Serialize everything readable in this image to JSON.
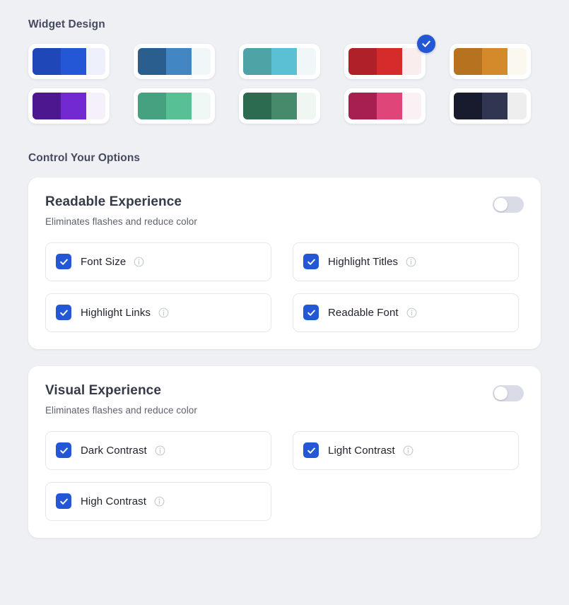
{
  "sections": {
    "widget_design_heading": "Widget Design",
    "control_options_heading": "Control Your Options"
  },
  "theme": {
    "accent": "#2457d6",
    "page_background": "#eef0f4",
    "card_background": "#ffffff",
    "heading_color": "#454a5f"
  },
  "swatches": [
    {
      "name": "blue",
      "selected": false,
      "colors": [
        "#1f47b8",
        "#2457d6",
        "#eef1fb"
      ]
    },
    {
      "name": "steel-blue",
      "selected": false,
      "colors": [
        "#2a5e8f",
        "#4287c4",
        "#f1f6f9"
      ]
    },
    {
      "name": "teal",
      "selected": false,
      "colors": [
        "#4da3a6",
        "#5bc0d4",
        "#f0f7f8"
      ]
    },
    {
      "name": "red",
      "selected": true,
      "colors": [
        "#b02028",
        "#d62b2b",
        "#faeded"
      ]
    },
    {
      "name": "amber",
      "selected": false,
      "colors": [
        "#b7721f",
        "#d4892a",
        "#fbf8f0"
      ]
    },
    {
      "name": "purple",
      "selected": false,
      "colors": [
        "#4d178f",
        "#7229d1",
        "#f6f0fa"
      ]
    },
    {
      "name": "mint-green",
      "selected": false,
      "colors": [
        "#46a180",
        "#57c195",
        "#f0f8f5"
      ]
    },
    {
      "name": "forest-green",
      "selected": false,
      "colors": [
        "#2d6b50",
        "#448a6b",
        "#f0f7f3"
      ]
    },
    {
      "name": "magenta",
      "selected": false,
      "colors": [
        "#a71e51",
        "#e0457a",
        "#faf1f4"
      ]
    },
    {
      "name": "midnight",
      "selected": false,
      "colors": [
        "#181b2e",
        "#303552",
        "#eeeeef"
      ]
    }
  ],
  "cards": [
    {
      "name": "readable-experience",
      "title": "Readable Experience",
      "subtitle": "Eliminates flashes and reduce color",
      "toggle_on": false,
      "options": [
        {
          "label": "Font Size",
          "checked": true,
          "info": "info-icon"
        },
        {
          "label": "Highlight Titles",
          "checked": true,
          "info": "info-icon"
        },
        {
          "label": "Highlight Links",
          "checked": true,
          "info": "info-icon"
        },
        {
          "label": "Readable Font",
          "checked": true,
          "info": "info-icon"
        }
      ]
    },
    {
      "name": "visual-experience",
      "title": "Visual Experience",
      "subtitle": "Eliminates flashes and reduce color",
      "toggle_on": false,
      "options": [
        {
          "label": "Dark Contrast",
          "checked": true,
          "info": "info-icon"
        },
        {
          "label": "Light Contrast",
          "checked": true,
          "info": "info-icon"
        },
        {
          "label": "High Contrast",
          "checked": true,
          "info": "info-icon"
        }
      ]
    }
  ]
}
